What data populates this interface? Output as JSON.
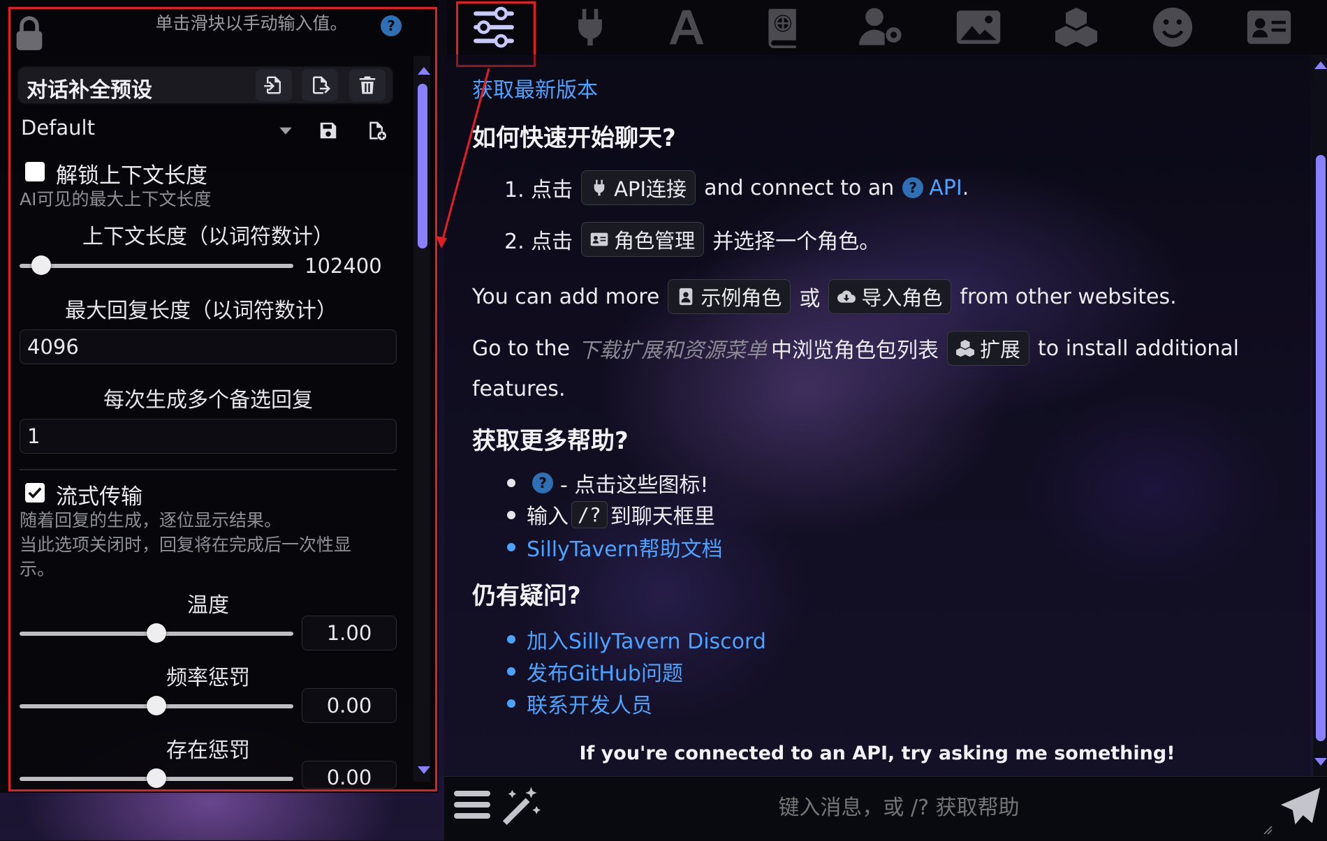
{
  "left_panel": {
    "hint": "单击滑块以手动输入值。",
    "help": "?",
    "preset_title": "对话补全预设",
    "preset_value": "Default",
    "unlock_context_label": "解锁上下文长度",
    "unlock_context_sub": "AI可见的最大上下文长度",
    "context_length_label": "上下文长度（以词符数计）",
    "context_length_value": "102400",
    "max_reply_label": "最大回复长度（以词符数计）",
    "max_reply_value": "4096",
    "multi_reply_label": "每次生成多个备选回复",
    "multi_reply_value": "1",
    "streaming_label": "流式传输",
    "streaming_sub1": "随着回复的生成，逐位显示结果。",
    "streaming_sub2": "当此选项关闭时，回复将在完成后一次性显",
    "streaming_sub3": "示。",
    "temperature_label": "温度",
    "temperature_value": "1.00",
    "frequency_label": "频率惩罚",
    "frequency_value": "0.00",
    "presence_label": "存在惩罚",
    "presence_value": "0.00",
    "sliders": {
      "context": 0.08,
      "temperature": 0.5,
      "frequency": 0.5,
      "presence": 0.5
    },
    "unlock_checked": false,
    "streaming_checked": true
  },
  "chat": {
    "get_latest": "获取最新版本",
    "quick_start_heading": "如何快速开始聊天?",
    "step1_prefix": "1. 点击",
    "step1_chip": "API连接",
    "step1_mid": "and connect to an",
    "step1_link": "API",
    "step1_end": ".",
    "step2_prefix": "2. 点击",
    "step2_chip": "角色管理",
    "step2_suffix": "并选择一个角色。",
    "add_more_prefix": "You can add more",
    "sample_chip": "示例角色",
    "or_text": "或",
    "import_chip": "导入角色",
    "add_more_suffix": "from other websites.",
    "goto_prefix": "Go to the",
    "goto_italic": "下载扩展和资源菜单",
    "goto_mid": "中浏览角色包列表",
    "ext_chip": "扩展",
    "goto_suffix": "to install additional",
    "goto_suffix2": "features.",
    "more_help_heading": "获取更多帮助?",
    "help_bullet1": "- 点击这些图标!",
    "help_bullet2_pre": "输入",
    "help_bullet2_code": "/?",
    "help_bullet2_post": "到聊天框里",
    "help_bullet3": "SillyTavern帮助文档",
    "questions_heading": "仍有疑问?",
    "q_link1": "加入SillyTavern Discord",
    "q_link2": "发布GitHub问题",
    "q_link3": "联系开发人员",
    "footer_note": "If you're connected to an API, try asking me something!"
  },
  "input": {
    "placeholder": "键入消息，或 /? 获取帮助"
  },
  "nav": {
    "icons": [
      "sliders-icon",
      "plug-icon",
      "font-icon",
      "book-globe-icon",
      "user-gear-icon",
      "image-icon",
      "cubes-icon",
      "smile-icon",
      "id-card-icon"
    ]
  },
  "colors": {
    "accent": "#8b80ff",
    "link": "#4aa3ff",
    "highlight": "#e31e24"
  }
}
